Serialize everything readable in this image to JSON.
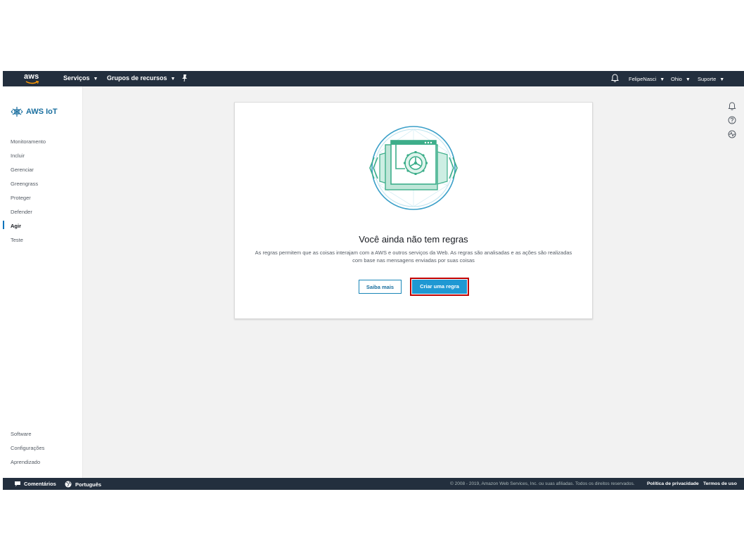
{
  "topnav": {
    "logo": "aws",
    "services": "Serviços",
    "resource_groups": "Grupos de recursos",
    "pin_icon": "pushpin-icon",
    "bell_icon": "bell-icon",
    "user": "FelipeNasci",
    "region": "Ohio",
    "support": "Suporte"
  },
  "sidebar": {
    "brand": "AWS IoT",
    "items": [
      {
        "label": "Monitoramento"
      },
      {
        "label": "Incluir"
      },
      {
        "label": "Gerenciar"
      },
      {
        "label": "Greengrass"
      },
      {
        "label": "Proteger"
      },
      {
        "label": "Defender"
      },
      {
        "label": "Agir",
        "active": true
      },
      {
        "label": "Teste"
      }
    ],
    "bottom_items": [
      {
        "label": "Software"
      },
      {
        "label": "Configurações"
      },
      {
        "label": "Aprendizado"
      }
    ]
  },
  "utility_icons": [
    "bell-icon",
    "help-icon",
    "activity-icon"
  ],
  "empty_state": {
    "title": "Você ainda não tem regras",
    "description_line1": "As regras permitem que as coisas interajam com a AWS e outros serviços da Web. As regras são analisadas e as ações são realizadas",
    "description_line2": "com base nas mensagens enviadas por suas coisas",
    "learn_more": "Saiba mais",
    "create_rule": "Criar uma regra"
  },
  "footer": {
    "feedback": "Comentários",
    "language": "Português",
    "copyright": "© 2008 - 2019, Amazon Web Services, Inc. ou suas afiliadas. Todos os direitos reservados.",
    "privacy": "Política de privacidade",
    "terms": "Termos de uso"
  },
  "colors": {
    "nav_bg": "#232f3e",
    "primary_button": "#1f98d3",
    "highlight_frame": "#c00000",
    "illustration_green": "#3dae8a"
  }
}
